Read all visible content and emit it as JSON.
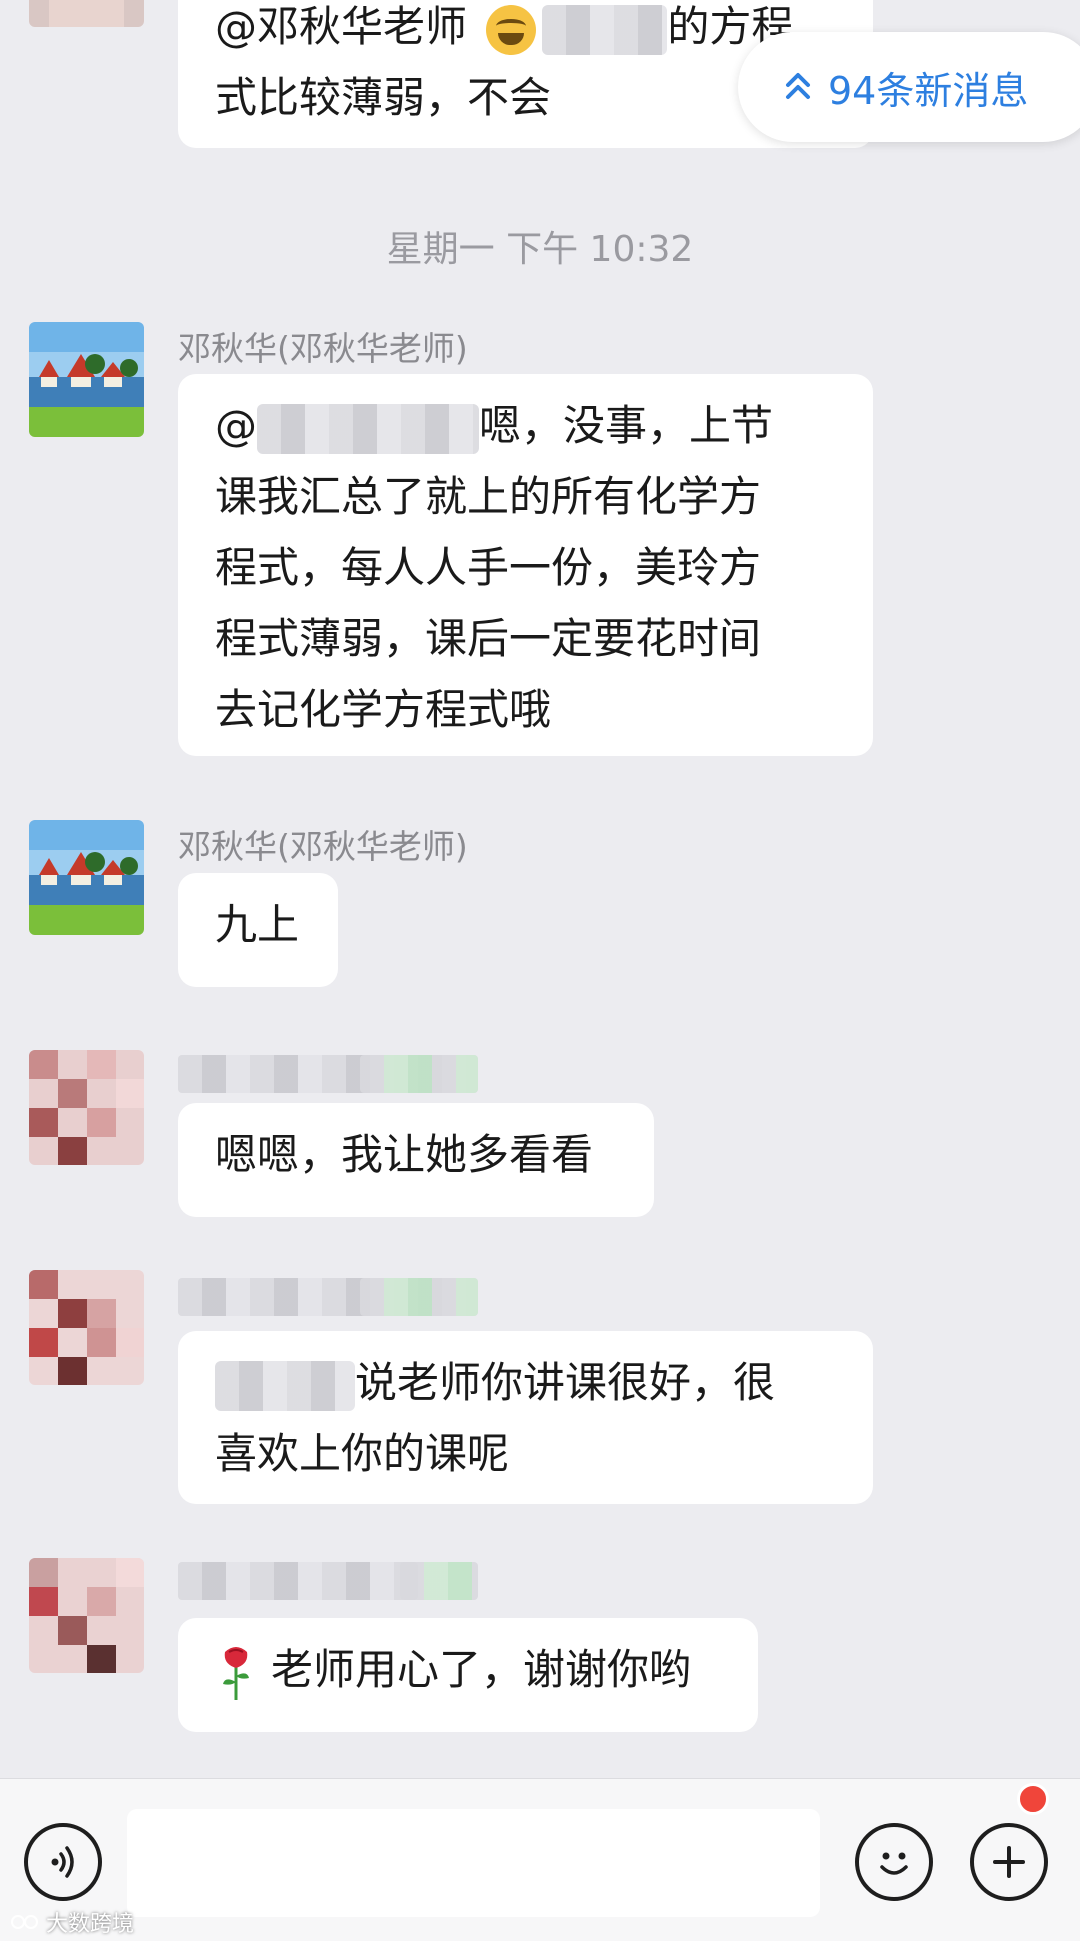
{
  "new_messages_pill": {
    "label": "94条新消息"
  },
  "timestamp": "星期一  下午 10:32",
  "messages": [
    {
      "id": "m0",
      "lines": [
        {
          "pre": "@邓秋华老师 ",
          "post": "的方程"
        },
        {
          "text": "式比较薄弱，不会"
        }
      ]
    },
    {
      "id": "m1",
      "sender": "邓秋华(邓秋华老师)",
      "lines": [
        {
          "pre": "@",
          "post": "嗯，没事，上节"
        },
        {
          "text": "课我汇总了就上的所有化学方"
        },
        {
          "text": "程式，每人人手一份，美玲方"
        },
        {
          "text": "程式薄弱，课后一定要花时间"
        },
        {
          "text": "去记化学方程式哦"
        }
      ]
    },
    {
      "id": "m2",
      "sender": "邓秋华(邓秋华老师)",
      "lines": [
        {
          "text": "九上"
        }
      ]
    },
    {
      "id": "m3",
      "lines": [
        {
          "text": "嗯嗯，我让她多看看"
        }
      ]
    },
    {
      "id": "m4",
      "lines": [
        {
          "post": "说老师你讲课很好，很"
        },
        {
          "text": "喜欢上你的课呢"
        }
      ]
    },
    {
      "id": "m5",
      "lines": [
        {
          "text": "老师用心了，谢谢你哟"
        }
      ]
    }
  ],
  "input_bar": {
    "placeholder": ""
  },
  "watermark": "大数跨境",
  "colors": {
    "accent": "#2d7fe0",
    "bubble": "#ffffff",
    "background": "#ececf0",
    "badge": "#f0453a"
  }
}
